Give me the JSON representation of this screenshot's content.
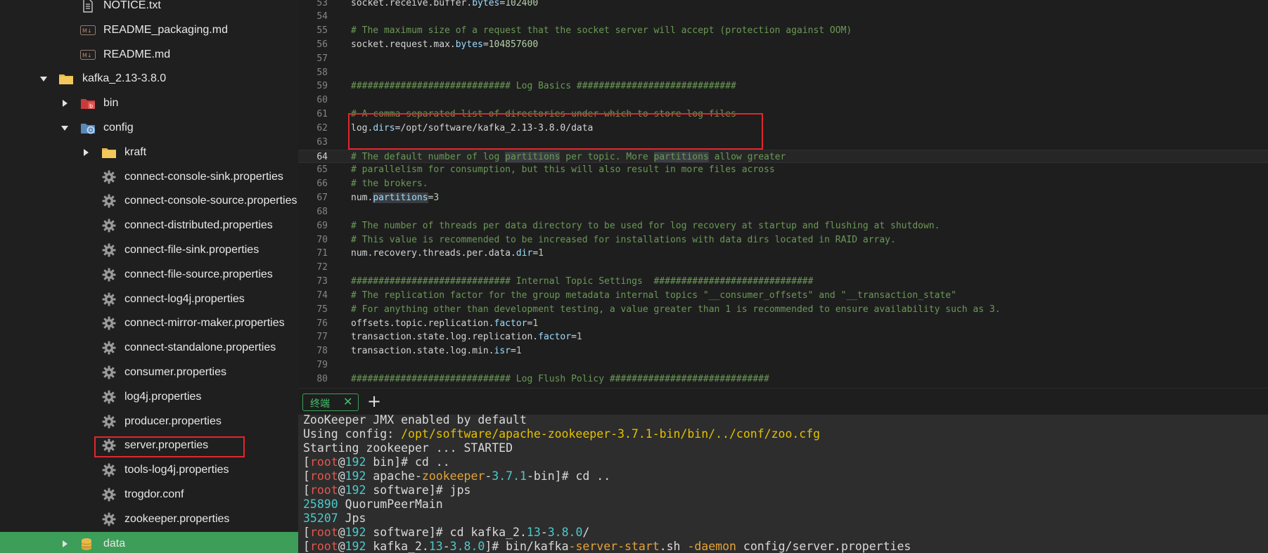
{
  "sidebar": {
    "items": [
      {
        "label": "NOTICE.txt",
        "icon": "text-file-icon"
      },
      {
        "label": "README_packaging.md",
        "icon": "markdown-file-icon"
      },
      {
        "label": "README.md",
        "icon": "markdown-file-icon"
      },
      {
        "label": "kafka_2.13-3.8.0",
        "icon": "folder-icon",
        "expanded": true
      },
      {
        "label": "bin",
        "icon": "bin-folder-icon",
        "expanded": false
      },
      {
        "label": "config",
        "icon": "config-folder-icon",
        "expanded": true
      },
      {
        "label": "kraft",
        "icon": "folder-icon",
        "expanded": false
      },
      {
        "label": "connect-console-sink.properties",
        "icon": "gear-icon"
      },
      {
        "label": "connect-console-source.properties",
        "icon": "gear-icon"
      },
      {
        "label": "connect-distributed.properties",
        "icon": "gear-icon"
      },
      {
        "label": "connect-file-sink.properties",
        "icon": "gear-icon"
      },
      {
        "label": "connect-file-source.properties",
        "icon": "gear-icon"
      },
      {
        "label": "connect-log4j.properties",
        "icon": "gear-icon"
      },
      {
        "label": "connect-mirror-maker.properties",
        "icon": "gear-icon"
      },
      {
        "label": "connect-standalone.properties",
        "icon": "gear-icon"
      },
      {
        "label": "consumer.properties",
        "icon": "gear-icon"
      },
      {
        "label": "log4j.properties",
        "icon": "gear-icon"
      },
      {
        "label": "producer.properties",
        "icon": "gear-icon"
      },
      {
        "label": "server.properties",
        "icon": "gear-icon"
      },
      {
        "label": "tools-log4j.properties",
        "icon": "gear-icon"
      },
      {
        "label": "trogdor.conf",
        "icon": "gear-icon"
      },
      {
        "label": "zookeeper.properties",
        "icon": "gear-icon"
      },
      {
        "label": "data",
        "icon": "database-folder-icon",
        "expanded": false,
        "selected": true
      }
    ]
  },
  "editor": {
    "current_line": "64",
    "lines": [
      {
        "n": "53",
        "text": "socket.receive.buffer.bytes=102400"
      },
      {
        "n": "54",
        "text": ""
      },
      {
        "n": "55",
        "text": "# The maximum size of a request that the socket server will accept (protection against OOM)"
      },
      {
        "n": "56",
        "text": "socket.request.max.bytes=104857600"
      },
      {
        "n": "57",
        "text": ""
      },
      {
        "n": "58",
        "text": ""
      },
      {
        "n": "59",
        "text": "############################# Log Basics #############################"
      },
      {
        "n": "60",
        "text": ""
      },
      {
        "n": "61",
        "text": "# A comma separated list of directories under which to store log files"
      },
      {
        "n": "62",
        "text": "log.dirs=/opt/software/kafka_2.13-3.8.0/data"
      },
      {
        "n": "63",
        "text": ""
      },
      {
        "n": "64",
        "text": "# The default number of log partitions per topic. More partitions allow greater"
      },
      {
        "n": "65",
        "text": "# parallelism for consumption, but this will also result in more files across"
      },
      {
        "n": "66",
        "text": "# the brokers."
      },
      {
        "n": "67",
        "text": "num.partitions=3"
      },
      {
        "n": "68",
        "text": ""
      },
      {
        "n": "69",
        "text": "# The number of threads per data directory to be used for log recovery at startup and flushing at shutdown."
      },
      {
        "n": "70",
        "text": "# This value is recommended to be increased for installations with data dirs located in RAID array."
      },
      {
        "n": "71",
        "text": "num.recovery.threads.per.data.dir=1"
      },
      {
        "n": "72",
        "text": ""
      },
      {
        "n": "73",
        "text": "############################# Internal Topic Settings  #############################"
      },
      {
        "n": "74",
        "text": "# The replication factor for the group metadata internal topics \"__consumer_offsets\" and \"__transaction_state\""
      },
      {
        "n": "75",
        "text": "# For anything other than development testing, a value greater than 1 is recommended to ensure availability such as 3."
      },
      {
        "n": "76",
        "text": "offsets.topic.replication.factor=1"
      },
      {
        "n": "77",
        "text": "transaction.state.log.replication.factor=1"
      },
      {
        "n": "78",
        "text": "transaction.state.log.min.isr=1"
      },
      {
        "n": "79",
        "text": ""
      },
      {
        "n": "80",
        "text": "############################# Log Flush Policy #############################"
      }
    ]
  },
  "terminal": {
    "tab_label": "终端",
    "close_glyph": "✕",
    "add_glyph": "+",
    "lines": [
      "ZooKeeper JMX enabled by default",
      "Using config: /opt/software/apache-zookeeper-3.7.1-bin/bin/../conf/zoo.cfg",
      "Starting zookeeper ... STARTED",
      "[root@192 bin]# cd ..",
      "[root@192 apache-zookeeper-3.7.1-bin]# cd ..",
      "[root@192 software]# jps",
      "25890 QuorumPeerMain",
      "35207 Jps",
      "[root@192 software]# cd kafka_2.13-3.8.0/",
      "[root@192 kafka_2.13-3.8.0]# bin/kafka-server-start.sh -daemon config/server.properties"
    ]
  },
  "colors": {
    "accent_green": "#3c9e58",
    "highlight_red": "#e0262d",
    "terminal_bg": "#2d2d2d",
    "editor_bg": "#1e1e1e"
  }
}
